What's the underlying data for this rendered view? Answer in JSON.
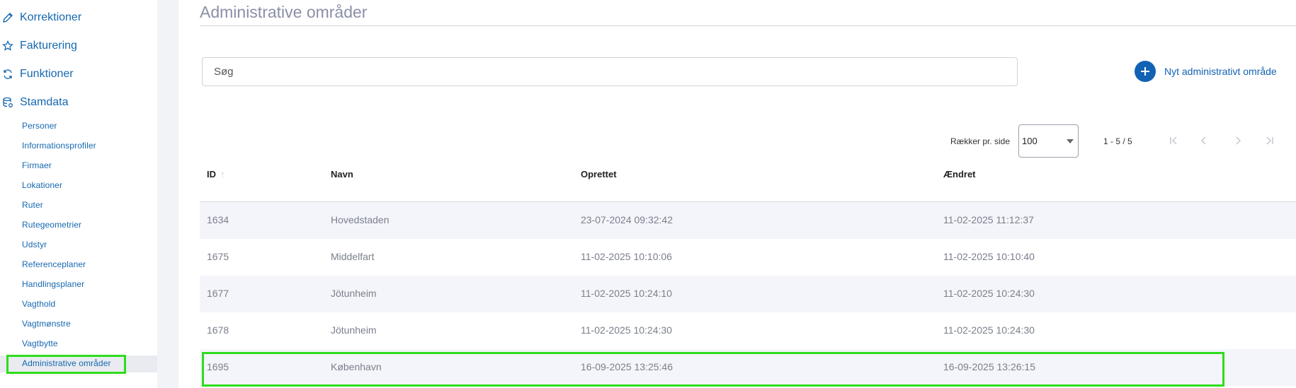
{
  "sidebar": {
    "top_items": [
      {
        "label": "Korrektioner",
        "icon": "pencil-icon"
      },
      {
        "label": "Fakturering",
        "icon": "star-icon"
      },
      {
        "label": "Funktioner",
        "icon": "refresh-icon"
      },
      {
        "label": "Stamdata",
        "icon": "database-icon"
      }
    ],
    "sub_items": [
      {
        "label": "Personer"
      },
      {
        "label": "Informationsprofiler"
      },
      {
        "label": "Firmaer"
      },
      {
        "label": "Lokationer"
      },
      {
        "label": "Ruter"
      },
      {
        "label": "Rutegeometrier"
      },
      {
        "label": "Udstyr"
      },
      {
        "label": "Referenceplaner"
      },
      {
        "label": "Handlingsplaner"
      },
      {
        "label": "Vagthold"
      },
      {
        "label": "Vagtmønstre"
      },
      {
        "label": "Vagtbytte"
      },
      {
        "label": "Administrative områder",
        "active": true
      }
    ]
  },
  "main": {
    "title": "Administrative områder",
    "search": {
      "placeholder": "Søg",
      "value": ""
    },
    "add_button": {
      "label": "Nyt administrativt område",
      "icon": "plus-icon"
    },
    "pagination": {
      "rows_label": "Rækker pr. side",
      "rows_value": "100",
      "range": "1 - 5 / 5",
      "icons": [
        "first-page-icon",
        "previous-page-icon",
        "next-page-icon",
        "last-page-icon"
      ]
    },
    "table": {
      "columns": [
        "ID",
        "Navn",
        "Oprettet",
        "Ændret"
      ],
      "sort_icon": "sort-up-icon",
      "rows": [
        {
          "id": "1634",
          "name": "Hovedstaden",
          "created": "23-07-2024 09:32:42",
          "modified": "11-02-2025 11:12:37"
        },
        {
          "id": "1675",
          "name": "Middelfart",
          "created": "11-02-2025 10:10:06",
          "modified": "11-02-2025 10:10:40"
        },
        {
          "id": "1677",
          "name": "Jötunheim",
          "created": "11-02-2025 10:24:10",
          "modified": "11-02-2025 10:24:30"
        },
        {
          "id": "1678",
          "name": "Jötunheim",
          "created": "11-02-2025 10:24:30",
          "modified": "11-02-2025 10:24:30"
        },
        {
          "id": "1695",
          "name": "København",
          "created": "16-09-2025 13:25:46",
          "modified": "16-09-2025 13:26:15"
        }
      ]
    }
  },
  "colors": {
    "accent": "#1668b0",
    "highlight": "#2fdc1c",
    "row_alt": "#f4f5fa"
  }
}
